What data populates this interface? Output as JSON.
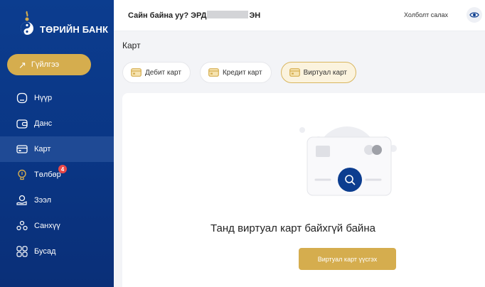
{
  "brand": {
    "name": "ТӨРИЙН БАНК"
  },
  "sidebar": {
    "transaction_button": "Гүйлгээ",
    "items": [
      {
        "label": "Нүүр",
        "icon": "home-icon"
      },
      {
        "label": "Данс",
        "icon": "wallet-icon"
      },
      {
        "label": "Карт",
        "icon": "card-icon",
        "active": true
      },
      {
        "label": "Төлбөр",
        "icon": "bulb-icon",
        "badge": "4"
      },
      {
        "label": "Зээл",
        "icon": "loan-icon"
      },
      {
        "label": "Санхүү",
        "icon": "finance-icon"
      },
      {
        "label": "Бусад",
        "icon": "grid-icon"
      }
    ]
  },
  "header": {
    "greeting_prefix": "Сайн байна уу? ЭРД",
    "greeting_suffix": "ЭН",
    "toggle_label": "Холболт салах"
  },
  "main": {
    "title": "Карт",
    "tabs": [
      {
        "label": "Дебит карт"
      },
      {
        "label": "Кредит карт"
      },
      {
        "label": "Виртуал карт",
        "active": true
      }
    ],
    "empty_message": "Танд виртуал карт байхгүй байна",
    "create_button": "Виртуал карт үүсгэх"
  },
  "colors": {
    "sidebar_bg": "#0c3d8f",
    "accent_gold": "#d5ad4e",
    "badge_red": "#e94848"
  }
}
